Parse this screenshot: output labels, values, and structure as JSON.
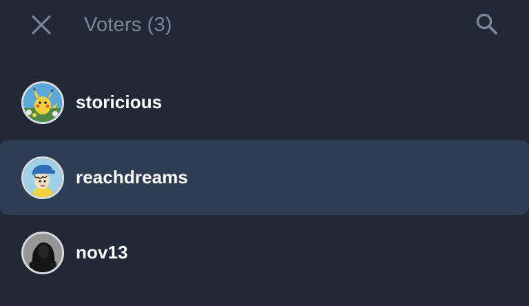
{
  "header": {
    "close_icon": "close-icon",
    "title": "Voters (3)",
    "search_icon": "search-icon"
  },
  "voters": [
    {
      "username": "storicious",
      "avatar": "pikachu-avatar",
      "selected": false
    },
    {
      "username": "reachdreams",
      "avatar": "cartoon-boy-avatar",
      "selected": true
    },
    {
      "username": "nov13",
      "avatar": "dark-portrait-avatar",
      "selected": false
    }
  ],
  "colors": {
    "background": "#212936",
    "selected_row": "#2f3d52",
    "title_text": "#7a8797",
    "icon": "#7a8797",
    "username_text": "#ffffff"
  }
}
